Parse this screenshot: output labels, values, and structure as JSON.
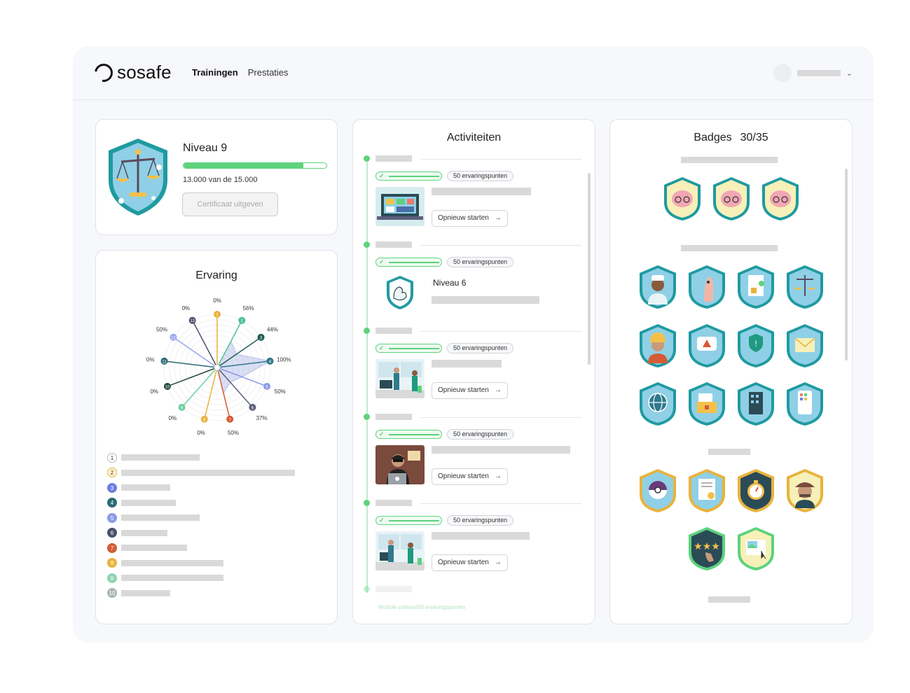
{
  "header": {
    "logo_text": "sosafe",
    "nav": {
      "active": "Trainingen",
      "second": "Prestaties"
    },
    "user_chevron": "⌄"
  },
  "level": {
    "title": "Niveau 9",
    "progress_fraction": 0.84,
    "xp_current": "13.000",
    "xp_sep": "van de",
    "xp_total": "15.000",
    "certificate_button": "Certificaat uitgeven"
  },
  "experience": {
    "title": "Ervaring",
    "chart_data": {
      "type": "radar",
      "axes": [
        "1",
        "2",
        "3",
        "4",
        "5",
        "6",
        "7",
        "8",
        "9",
        "10",
        "11",
        "12",
        "13"
      ],
      "values": [
        0,
        56,
        44,
        100,
        50,
        37,
        50,
        0,
        0,
        0,
        0,
        50,
        0
      ],
      "labels": [
        "0%",
        "56%",
        "44%",
        "100%",
        "50%",
        "37%",
        "50%",
        "0%",
        "0%",
        "0%",
        "0%",
        "50%",
        "0%"
      ],
      "colors": [
        "#e8b33c",
        "#4bbf9a",
        "#1f5f53",
        "#2f7a8c",
        "#8a9ae8",
        "#5b5f7a",
        "#d45b36",
        "#e8b33c",
        "#6fcf9f",
        "#274a3c",
        "#2b6b74",
        "#9aa4f0",
        "#4b4f6b"
      ]
    },
    "legend": [
      {
        "num": "1",
        "color": "#ffffff",
        "text_color": "#333",
        "border": "#bbb"
      },
      {
        "num": "2",
        "color": "#fff6d6",
        "text_color": "#333",
        "border": "#e8b33c"
      },
      {
        "num": "3",
        "color": "#6c7ee0",
        "text_color": "#fff",
        "border": "#6c7ee0"
      },
      {
        "num": "4",
        "color": "#2b6b74",
        "text_color": "#fff",
        "border": "#2b6b74"
      },
      {
        "num": "5",
        "color": "#8a9ae8",
        "text_color": "#fff",
        "border": "#8a9ae8"
      },
      {
        "num": "6",
        "color": "#4b4f6b",
        "text_color": "#fff",
        "border": "#4b4f6b"
      },
      {
        "num": "7",
        "color": "#d45b36",
        "text_color": "#fff",
        "border": "#d45b36"
      },
      {
        "num": "8",
        "color": "#e8b33c",
        "text_color": "#fff",
        "border": "#e8b33c"
      },
      {
        "num": "9",
        "color": "#8fd4b4",
        "text_color": "#fff",
        "border": "#8fd4b4"
      },
      {
        "num": "10",
        "color": "#a9b8b0",
        "text_color": "#fff",
        "border": "#a9b8b0"
      }
    ]
  },
  "activities": {
    "title": "Activiteiten",
    "xp_label": "50 ervaringspunten",
    "restart_label": "Opnieuw starten",
    "arrow": "→",
    "check": "✓",
    "level6_title": "Niveau 6",
    "faded_label": "Module voltooid",
    "faded_xp": "50 ervaringspunten"
  },
  "badges": {
    "title": "Badges",
    "count": "30/35"
  }
}
